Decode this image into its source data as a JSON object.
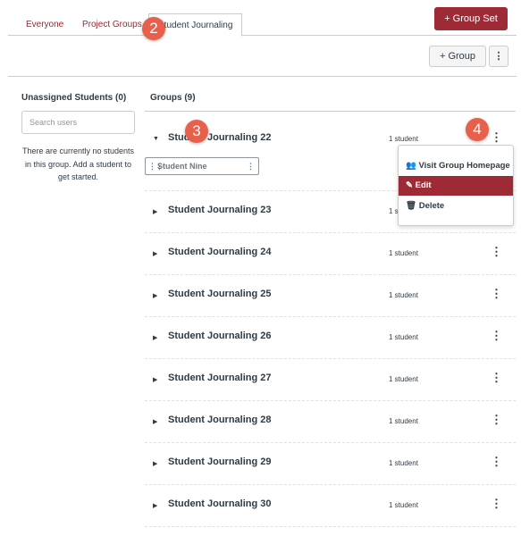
{
  "tabs": [
    {
      "label": "Everyone"
    },
    {
      "label": "Project Groups"
    },
    {
      "label": "Student Journaling"
    }
  ],
  "toolbar": {
    "group_set_label": "+ Group Set",
    "group_label": "+ Group",
    "more": "⋮"
  },
  "left": {
    "title": "Unassigned Students (0)",
    "search_placeholder": "Search users",
    "empty_text": "There are currently no students in this group. Add a student to get started."
  },
  "groups": {
    "title": "Groups (9)",
    "items": [
      {
        "name": "Student Journaling 22",
        "count": "1 student",
        "expanded": true
      },
      {
        "name": "Student Journaling 23",
        "count": "1 student"
      },
      {
        "name": "Student Journaling 24",
        "count": "1 student"
      },
      {
        "name": "Student Journaling 25",
        "count": "1 student"
      },
      {
        "name": "Student Journaling 26",
        "count": "1 student"
      },
      {
        "name": "Student Journaling 27",
        "count": "1 student"
      },
      {
        "name": "Student Journaling 28",
        "count": "1 student"
      },
      {
        "name": "Student Journaling 29",
        "count": "1 student"
      },
      {
        "name": "Student Journaling 30",
        "count": "1 student"
      }
    ],
    "member": "Student Nine"
  },
  "menu": {
    "items": [
      {
        "label": "Visit Group Homepage",
        "icon": "users-icon"
      },
      {
        "label": "Edit",
        "icon": "pencil-icon",
        "selected": true
      },
      {
        "label": "Delete",
        "icon": "trash-icon"
      }
    ]
  },
  "badges": [
    "2",
    "3",
    "4"
  ],
  "colors": {
    "accent": "#9e2a36",
    "badge": "#e8604c",
    "link": "#a0262f"
  }
}
